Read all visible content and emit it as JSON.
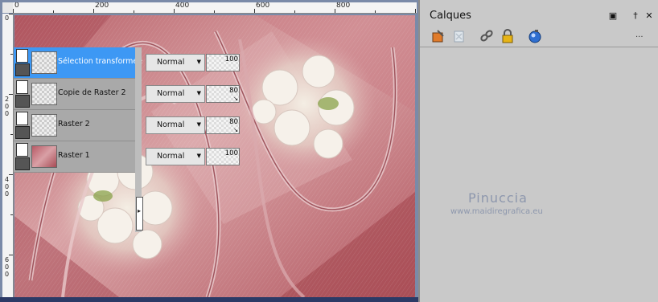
{
  "ruler": {
    "top_labels": [
      "0",
      "200",
      "400",
      "600",
      "800"
    ],
    "left_labels": [
      [
        "0"
      ],
      [
        "2",
        "0",
        "0"
      ],
      [
        "4",
        "0",
        "0"
      ],
      [
        "6",
        "0",
        "0"
      ]
    ]
  },
  "panel": {
    "title": "Calques",
    "buttons": {
      "dock": "▣",
      "pin": "†",
      "close": "✕",
      "more": "..."
    }
  },
  "toolbar": {
    "icons": [
      "new-layer-icon",
      "delete-layer-icon",
      "link-icon",
      "lock-icon",
      "mask-icon"
    ]
  },
  "layers": [
    {
      "name": "Sélection transformée",
      "blend": "Normal",
      "opacity": "100",
      "selected": true
    },
    {
      "name": "Copie de Raster 2",
      "blend": "Normal",
      "opacity": "80",
      "selected": false
    },
    {
      "name": "Raster 2",
      "blend": "Normal",
      "opacity": "80",
      "selected": false
    },
    {
      "name": "Raster 1",
      "blend": "Normal",
      "opacity": "100",
      "selected": false
    }
  ],
  "watermark": {
    "name": "Pinuccia",
    "url": "www.maidiregrafica.eu"
  },
  "colors": {
    "selection": "#3d98f4",
    "canvas_rose": "#c9777c",
    "panel_bg": "#c9c9c9"
  }
}
